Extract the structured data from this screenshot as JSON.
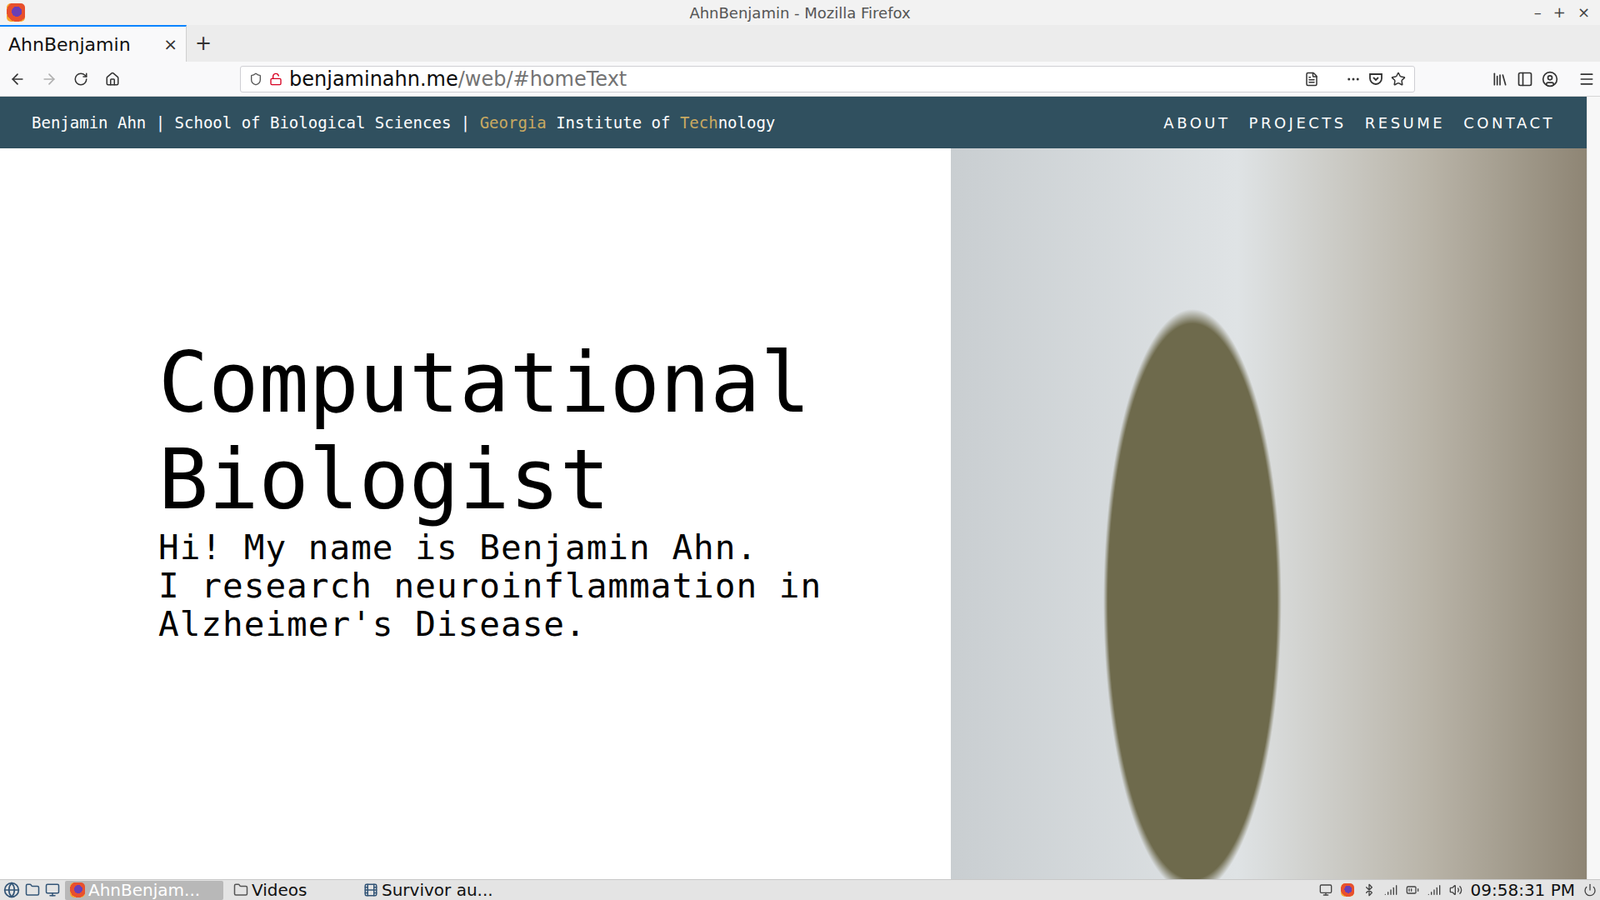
{
  "window": {
    "title": "AhnBenjamin - Mozilla Firefox",
    "controls": [
      "–",
      "+",
      "×"
    ]
  },
  "tabs": [
    {
      "label": "AhnBenjamin",
      "selected": true,
      "close": "×"
    }
  ],
  "new_tab": "+",
  "history": {
    "back_disabled": false,
    "forward_disabled": true
  },
  "address_bar": {
    "host": "benjaminahn.me",
    "path": "/web/#homeText"
  },
  "site": {
    "header": [
      {
        "text": "Benjamin Ahn | School of Biological Sciences | ",
        "color": "#ffffff"
      },
      {
        "text": "Georgia",
        "color": "#c9a961"
      },
      {
        "text": " Institute of ",
        "color": "#ffffff"
      },
      {
        "text": "Tech",
        "color": "#c9a961"
      },
      {
        "text": "nology",
        "color": "#ffffff"
      }
    ],
    "nav": [
      "ABOUT",
      "PROJECTS",
      "RESUME",
      "CONTACT"
    ],
    "heading": [
      "Computational",
      "Biologist"
    ],
    "intro": [
      "Hi! My name is Benjamin Ahn.",
      "I research neuroinflammation in",
      "Alzheimer's Disease."
    ]
  },
  "taskbar": {
    "tasks": [
      {
        "label": "AhnBenjam...",
        "selected": true,
        "kind": "browser"
      },
      {
        "label": "Videos",
        "selected": false,
        "kind": "folder"
      },
      {
        "label": "Survivor au...",
        "selected": false,
        "kind": "media"
      }
    ],
    "clock": "09:58:31 PM"
  }
}
